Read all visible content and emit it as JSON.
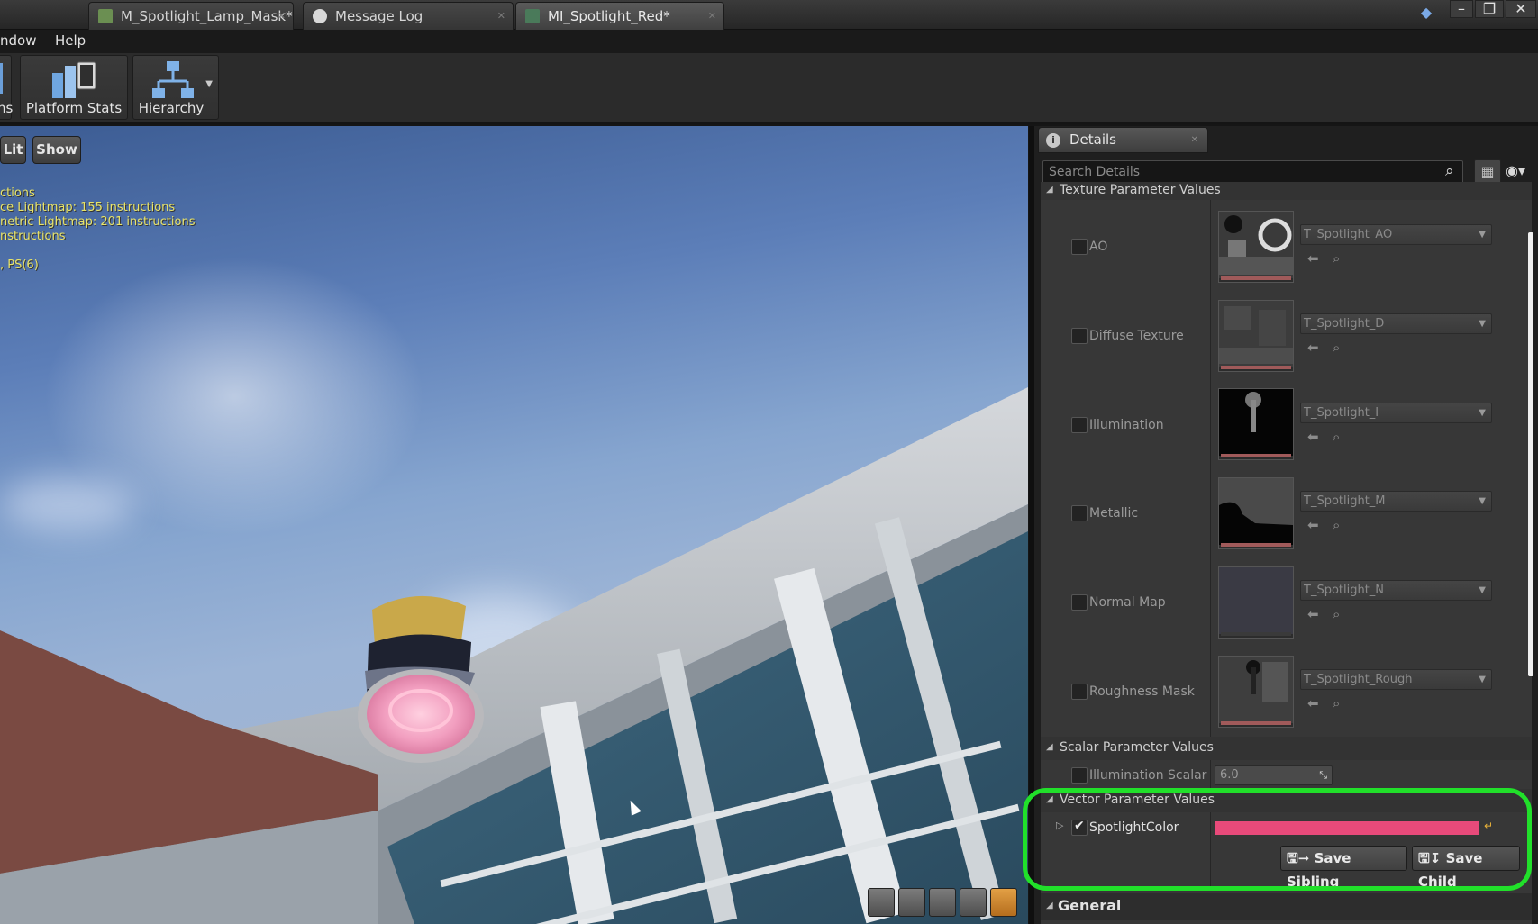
{
  "tabs": [
    {
      "label": "M_Spotlight_Lamp_Mask*",
      "active": false
    },
    {
      "label": "Message Log",
      "active": false
    },
    {
      "label": "MI_Spotlight_Red*",
      "active": true
    }
  ],
  "menu": [
    "ndow",
    "Help"
  ],
  "toolbar": {
    "partial_label": "ns",
    "platform_stats": "Platform Stats",
    "hierarchy": "Hierarchy"
  },
  "viewport": {
    "lit_label": "Lit",
    "show_label": "Show",
    "stats": [
      "ctions",
      "ce Lightmap: 155 instructions",
      "netric Lightmap: 201 instructions",
      "nstructions",
      ", PS(6)"
    ]
  },
  "details": {
    "tab_label": "Details",
    "search_placeholder": "Search Details",
    "texture_section": "Texture Parameter Values",
    "textures": [
      {
        "label": "AO",
        "value": "T_Spotlight_AO"
      },
      {
        "label": "Diffuse Texture",
        "value": "T_Spotlight_D"
      },
      {
        "label": "Illumination",
        "value": "T_Spotlight_I"
      },
      {
        "label": "Metallic",
        "value": "T_Spotlight_M"
      },
      {
        "label": "Normal Map",
        "value": "T_Spotlight_N"
      },
      {
        "label": "Roughness Mask",
        "value": "T_Spotlight_Rough"
      }
    ],
    "scalar_section": "Scalar Parameter Values",
    "scalar_label": "Illumination Scalar",
    "scalar_value": "6.0",
    "vector_section": "Vector Parameter Values",
    "vector_label": "SpotlightColor",
    "vector_color": "#e84a7a",
    "save_sibling": "Save Sibling",
    "save_child": "Save Child",
    "general_section": "General"
  }
}
